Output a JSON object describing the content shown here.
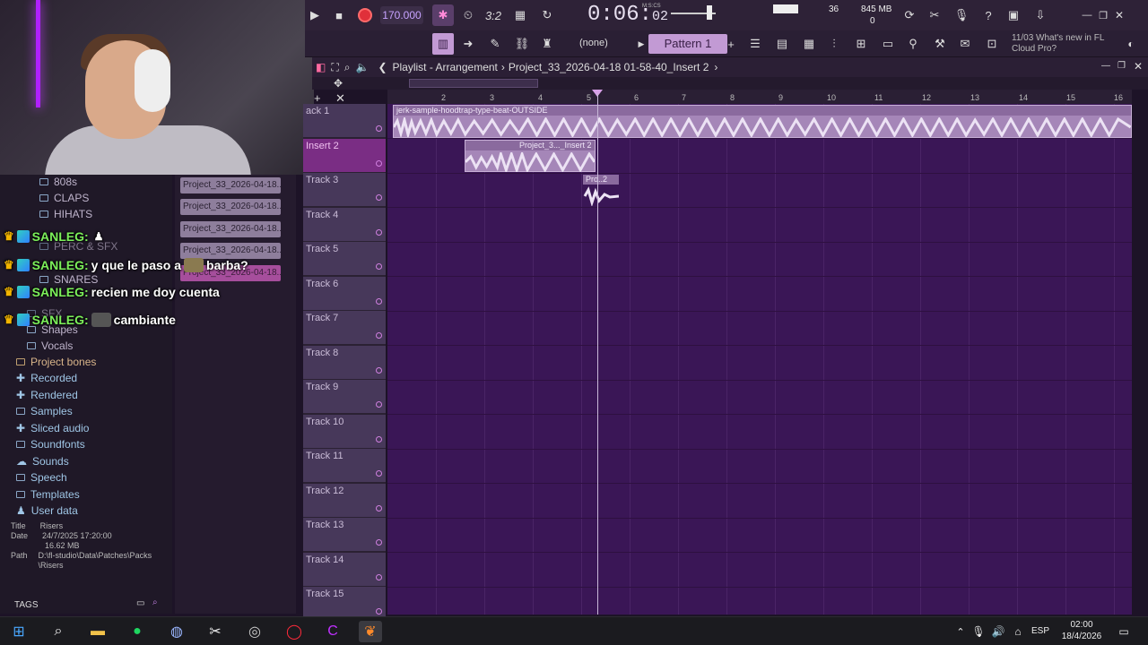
{
  "transport": {
    "tempo": "170.000",
    "time_main": "0:06:",
    "time_sub": "02",
    "time_mode": "M:S:CS",
    "cpu_value": "36",
    "memory": "845 MB",
    "poly": "0",
    "snap": "(none)",
    "pattern": "Pattern 1",
    "news_line1": "11/03  What's new in FL",
    "news_line2": "Cloud Pro?"
  },
  "playlist": {
    "title": "Playlist - Arrangement",
    "breadcrumb": "Project_33_2026-04-18 01-58-40_Insert 2",
    "ruler": [
      "2",
      "3",
      "4",
      "5",
      "6",
      "7",
      "8",
      "9",
      "10",
      "11",
      "12",
      "13",
      "14",
      "15",
      "16"
    ],
    "tracks": [
      "ack 1",
      "Insert 2",
      "Track 3",
      "Track 4",
      "Track 5",
      "Track 6",
      "Track 7",
      "Track 8",
      "Track 9",
      "Track 10",
      "Track 11",
      "Track 12",
      "Track 13",
      "Track 14",
      "Track 15"
    ],
    "clips": {
      "clip1": "jerk-sample-hoodtrap-type-beat-OUTSIDE",
      "clip2": "Project_3..._Insert 2",
      "clip3": "Pro..2"
    }
  },
  "browser": {
    "folders": [
      "808s",
      "CLAPS",
      "HIHATS",
      "PERC & SFX",
      "SNARES",
      "SFX",
      "Shapes",
      "Vocals"
    ],
    "items": [
      "Project bones",
      "Recorded",
      "Rendered",
      "Samples",
      "Sliced audio",
      "Soundfonts",
      "Sounds",
      "Speech",
      "Templates",
      "User data"
    ],
    "info_title_label": "Title",
    "info_title": "Risers",
    "info_date_label": "Date",
    "info_date": "24/7/2025 17:20:00",
    "info_size": "16.62 MB",
    "info_path_label": "Path",
    "info_path": "D:\\fl-studio\\Data\\Patches\\Packs\\Risers",
    "tags_label": "TAGS"
  },
  "picker": [
    "Project_33_2026-04-18...",
    "Project_33_2026-04-18...",
    "Project_33_2026-04-18...",
    "Project_33_2026-04-18...",
    "Project_33_2026-04-18..."
  ],
  "chat": [
    {
      "name": "SANLEG:",
      "text": ""
    },
    {
      "name": "SANLEG:",
      "text": "y que le paso a",
      "text2": "barba?"
    },
    {
      "name": "SANLEG:",
      "text": "recien me doy cuenta"
    },
    {
      "name": "SANLEG:",
      "text": "cambiante"
    }
  ],
  "taskbar": {
    "lang": "ESP",
    "time": "02:00",
    "date": "18/4/2026"
  },
  "colors": {
    "accent": "#c29ad4",
    "grid_bg": "#3a1656",
    "selected_track": "#7a2d84",
    "chat_name": "#7cf05a"
  }
}
